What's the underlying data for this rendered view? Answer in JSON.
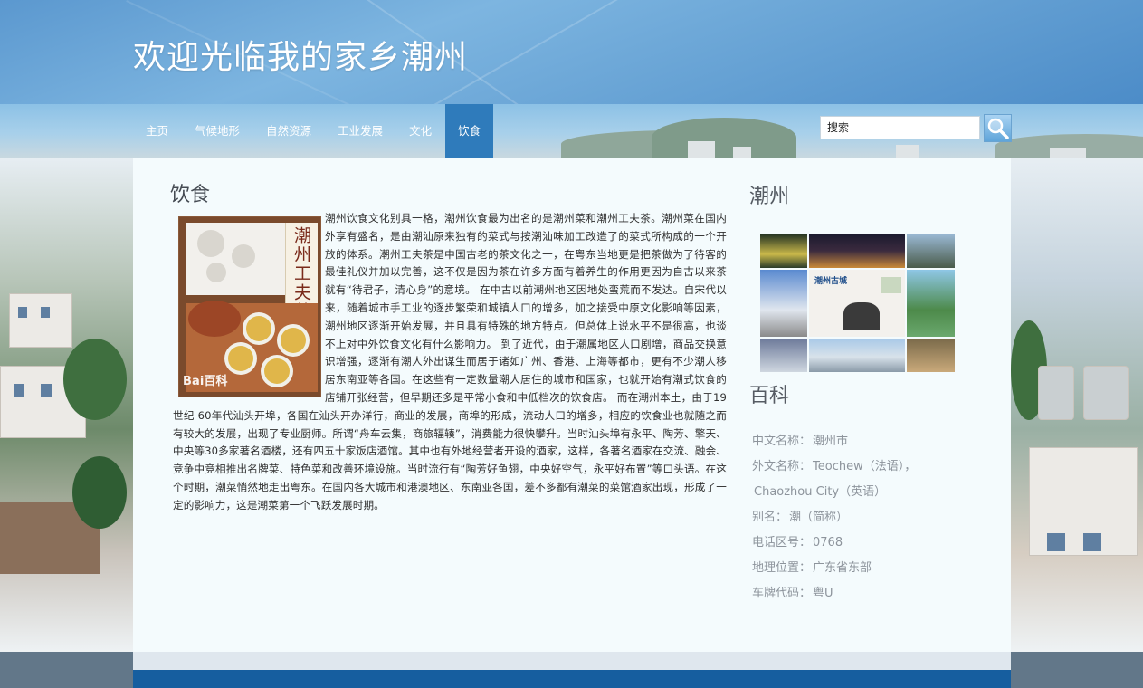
{
  "header": {
    "site_title": "欢迎光临我的家乡潮州"
  },
  "nav": {
    "items": [
      {
        "label": "主页",
        "active": false
      },
      {
        "label": "气候地形",
        "active": false
      },
      {
        "label": "自然资源",
        "active": false
      },
      {
        "label": "工业发展",
        "active": false
      },
      {
        "label": "文化",
        "active": false
      },
      {
        "label": "饮食",
        "active": true
      }
    ],
    "active_color": "#2f7bbb"
  },
  "search": {
    "placeholder": "搜索",
    "button_icon": "magnifier-icon"
  },
  "article": {
    "heading": "饮食",
    "text": "潮州饮食文化别具一格，潮州饮食最为出名的是潮州菜和潮州工夫茶。潮州菜在国内外享有盛名，是由潮汕原来独有的菜式与按潮汕味加工改造了的菜式所构成的一个开放的体系。潮州工夫茶是中国古老的茶文化之一，在粤东当地更是把茶做为了待客的最佳礼仪并加以完善，这不仅是因为茶在许多方面有着养生的作用更因为自古以来茶就有“待君子，清心身”的意境。 在中古以前潮州地区因地处蛮荒而不发达。自宋代以来，随着城市手工业的逐步繁荣和城镇人口的增多，加之接受中原文化影响等因素，潮州地区逐渐开始发展，并且具有特殊的地方特点。但总体上说水平不是很高，也谈不上对中外饮食文化有什么影响力。 到了近代，由于潮属地区人口剧增，商品交换意识增强，逐渐有潮人外出谋生而居于诸如广州、香港、上海等都市，更有不少潮人移居东南亚等各国。在这些有一定数量潮人居住的城市和国家，也就开始有潮式饮食的店铺开张经营，但早期还多是平常小食和中低档次的饮食店。 而在潮州本土，由于19世纪 60年代汕头开埠，各国在汕头开办洋行，商业的发展，商埠的形成，流动人口的增多，相应的饮食业也就随之而有较大的发展，出现了专业厨师。所谓“舟车云集，商旅辐辏”，消费能力很快攀升。当时汕头埠有永平、陶芳、擎天、中央等30多家著名酒楼，还有四五十家饭店酒馆。其中也有外地经营者开设的酒家，这样，各著名酒家在交流、融会、竞争中竞相推出名牌菜、特色菜和改善环境设施。当时流行有“陶芳好鱼翅，中央好空气，永平好布置”等口头语。在这个时期，潮菜悄然地走出粤东。在国内各大城市和港澳地区、东南亚各国，差不多都有潮菜的菜馆酒家出现，形成了一定的影响力，这是潮菜第一个飞跃发展时期。",
    "image": {
      "cover_text": "潮州工夫茶",
      "watermark": "Bai百科"
    }
  },
  "sidebar": {
    "city_heading": "潮州",
    "collage_caption": "潮州古城",
    "baike_heading": "百科",
    "info": [
      {
        "key": "中文名称：",
        "value": "潮州市"
      },
      {
        "key": "外文名称：",
        "value": "Teochew（法语），"
      },
      {
        "key": "",
        "value": "Chaozhou City（英语）"
      },
      {
        "key": "别名：",
        "value": "潮（简称）"
      },
      {
        "key": "电话区号：",
        "value": "0768"
      },
      {
        "key": "地理位置：",
        "value": "广东省东部"
      },
      {
        "key": "车牌代码：",
        "value": "粤U"
      }
    ]
  },
  "colors": {
    "header_blue": "#5b98cf",
    "panel_bg": "#f4fbfd",
    "footer_blue": "#165e9f",
    "info_text": "#8d949c"
  }
}
